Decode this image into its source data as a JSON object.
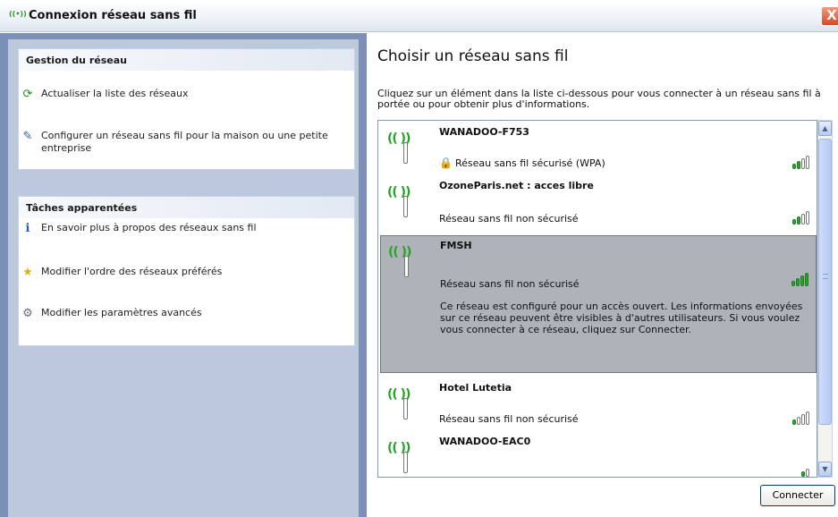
{
  "window": {
    "title": "Connexion réseau sans fil",
    "app_icon": "((•))",
    "close_label": "X"
  },
  "sidebar": {
    "network_tasks": {
      "header": "Gestion du réseau",
      "items": [
        {
          "label": "Actualiser la liste des réseaux",
          "icon": "refresh-icon",
          "glyph": "⟳"
        },
        {
          "label": "Configurer un réseau sans fil pour la maison ou une petite entreprise",
          "icon": "wireless-setup-icon",
          "glyph": "✎"
        }
      ]
    },
    "related_tasks": {
      "header": "Tâches apparentées",
      "items": [
        {
          "label": "En savoir plus à propos des réseaux sans fil",
          "icon": "info-icon",
          "glyph": "ℹ"
        },
        {
          "label": "Modifier l'ordre des réseaux préférés",
          "icon": "star-icon",
          "glyph": "★"
        },
        {
          "label": "Modifier les paramètres avancés",
          "icon": "wrench-icon",
          "glyph": "⚙"
        }
      ]
    }
  },
  "main": {
    "heading": "Choisir un réseau sans fil",
    "instructions": "Cliquez sur un élément dans la liste ci-dessous pour vous connecter à un réseau sans fil à portée ou pour obtenir plus d'informations.",
    "networks": [
      {
        "ssid": "WANADOO-F753",
        "security": "Réseau sans fil sécurisé (WPA)",
        "secured": true,
        "signal_bars": 2,
        "selected": false
      },
      {
        "ssid": "OzoneParis.net : acces libre",
        "security": "Réseau sans fil non sécurisé",
        "secured": false,
        "signal_bars": 2,
        "selected": false
      },
      {
        "ssid": "FMSH",
        "security": "Réseau sans fil non sécurisé",
        "secured": false,
        "signal_bars": 4,
        "selected": true,
        "description": "Ce réseau est configuré pour un accès ouvert. Les informations envoyées sur ce réseau peuvent être visibles à d'autres utilisateurs. Si vous voulez vous connecter à ce réseau, cliquez sur Connecter."
      },
      {
        "ssid": "Hotel Lutetia",
        "security": "Réseau sans fil non sécurisé",
        "secured": false,
        "signal_bars": 1,
        "selected": false
      },
      {
        "ssid": "WANADOO-EAC0",
        "security": "",
        "secured": false,
        "signal_bars": 1,
        "selected": false
      }
    ],
    "connect_label": "Connecter"
  },
  "colors": {
    "signal_green": "#2aa52a",
    "sidebar_bg": "#bcc9dd",
    "selected_bg": "#adb3b9"
  }
}
